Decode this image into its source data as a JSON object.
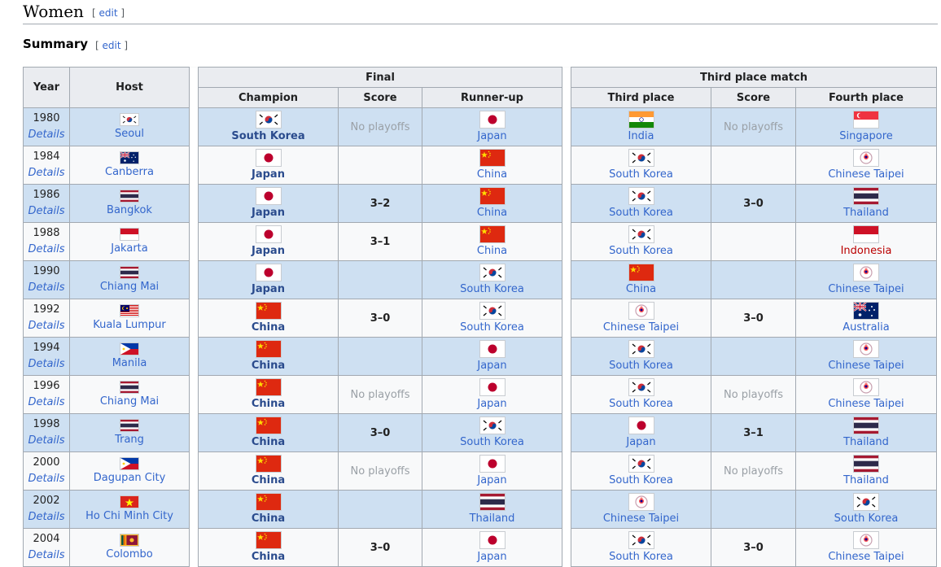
{
  "section": {
    "title": "Women",
    "edit_open": "[",
    "edit_label": "edit",
    "edit_close": "]"
  },
  "subsection": {
    "title": "Summary",
    "edit_open": "[",
    "edit_label": "edit",
    "edit_close": "]"
  },
  "table": {
    "headers": {
      "year": "Year",
      "host": "Host",
      "final": "Final",
      "third_place_match": "Third place match",
      "champion": "Champion",
      "score": "Score",
      "runner_up": "Runner-up",
      "third_place": "Third place",
      "score2": "Score",
      "fourth_place": "Fourth place"
    },
    "details_label": "Details",
    "rows": [
      {
        "year": "1980",
        "host": "Seoul",
        "host_flag": "korea",
        "champion": "South Korea",
        "champion_flag": "korea",
        "score": "No playoffs",
        "runner_up": "Japan",
        "runner_up_flag": "japan",
        "third": "India",
        "third_flag": "india",
        "score2": "No playoffs",
        "fourth": "Singapore",
        "fourth_flag": "singapore"
      },
      {
        "year": "1984",
        "host": "Canberra",
        "host_flag": "australia",
        "champion": "Japan",
        "champion_flag": "japan",
        "score": "",
        "runner_up": "China",
        "runner_up_flag": "china",
        "third": "South Korea",
        "third_flag": "korea",
        "score2": "",
        "fourth": "Chinese Taipei",
        "fourth_flag": "taipei"
      },
      {
        "year": "1986",
        "host": "Bangkok",
        "host_flag": "thailand",
        "champion": "Japan",
        "champion_flag": "japan",
        "score": "3–2",
        "runner_up": "China",
        "runner_up_flag": "china",
        "third": "South Korea",
        "third_flag": "korea",
        "score2": "3–0",
        "fourth": "Thailand",
        "fourth_flag": "thailand"
      },
      {
        "year": "1988",
        "host": "Jakarta",
        "host_flag": "indonesia",
        "champion": "Japan",
        "champion_flag": "japan",
        "score": "3–1",
        "runner_up": "China",
        "runner_up_flag": "china",
        "third": "South Korea",
        "third_flag": "korea",
        "score2": "",
        "fourth": "Indonesia",
        "fourth_flag": "indonesia",
        "fourth_red": true
      },
      {
        "year": "1990",
        "host": "Chiang Mai",
        "host_flag": "thailand",
        "champion": "Japan",
        "champion_flag": "japan",
        "score": "",
        "runner_up": "South Korea",
        "runner_up_flag": "korea",
        "third": "China",
        "third_flag": "china",
        "score2": "",
        "fourth": "Chinese Taipei",
        "fourth_flag": "taipei"
      },
      {
        "year": "1992",
        "host": "Kuala Lumpur",
        "host_flag": "malaysia",
        "champion": "China",
        "champion_flag": "china",
        "score": "3–0",
        "runner_up": "South Korea",
        "runner_up_flag": "korea",
        "third": "Chinese Taipei",
        "third_flag": "taipei",
        "score2": "3–0",
        "fourth": "Australia",
        "fourth_flag": "australia"
      },
      {
        "year": "1994",
        "host": "Manila",
        "host_flag": "philippines",
        "champion": "China",
        "champion_flag": "china",
        "score": "",
        "runner_up": "Japan",
        "runner_up_flag": "japan",
        "third": "South Korea",
        "third_flag": "korea",
        "score2": "",
        "fourth": "Chinese Taipei",
        "fourth_flag": "taipei"
      },
      {
        "year": "1996",
        "host": "Chiang Mai",
        "host_flag": "thailand",
        "champion": "China",
        "champion_flag": "china",
        "score": "No playoffs",
        "runner_up": "Japan",
        "runner_up_flag": "japan",
        "third": "South Korea",
        "third_flag": "korea",
        "score2": "No playoffs",
        "fourth": "Chinese Taipei",
        "fourth_flag": "taipei"
      },
      {
        "year": "1998",
        "host": "Trang",
        "host_flag": "thailand",
        "champion": "China",
        "champion_flag": "china",
        "score": "3–0",
        "runner_up": "South Korea",
        "runner_up_flag": "korea",
        "third": "Japan",
        "third_flag": "japan",
        "score2": "3–1",
        "fourth": "Thailand",
        "fourth_flag": "thailand"
      },
      {
        "year": "2000",
        "host": "Dagupan City",
        "host_flag": "philippines",
        "champion": "China",
        "champion_flag": "china",
        "score": "No playoffs",
        "runner_up": "Japan",
        "runner_up_flag": "japan",
        "third": "South Korea",
        "third_flag": "korea",
        "score2": "No playoffs",
        "fourth": "Thailand",
        "fourth_flag": "thailand"
      },
      {
        "year": "2002",
        "host": "Ho Chi Minh City",
        "host_flag": "vietnam",
        "champion": "China",
        "champion_flag": "china",
        "score": "",
        "runner_up": "Thailand",
        "runner_up_flag": "thailand",
        "third": "Chinese Taipei",
        "third_flag": "taipei",
        "score2": "",
        "fourth": "South Korea",
        "fourth_flag": "korea"
      },
      {
        "year": "2004",
        "host": "Colombo",
        "host_flag": "srilanka",
        "champion": "China",
        "champion_flag": "china",
        "score": "3–0",
        "runner_up": "Japan",
        "runner_up_flag": "japan",
        "third": "South Korea",
        "third_flag": "korea",
        "score2": "3–0",
        "fourth": "Chinese Taipei",
        "fourth_flag": "taipei"
      }
    ]
  },
  "colors": {
    "link": "#3366cc",
    "champion_link": "#2a4b8d",
    "red_link": "#ba0000",
    "row_blue": "#cee0f2",
    "row_white": "#f8f9fa",
    "header_bg": "#eaecf0",
    "border": "#a2a9b1"
  }
}
